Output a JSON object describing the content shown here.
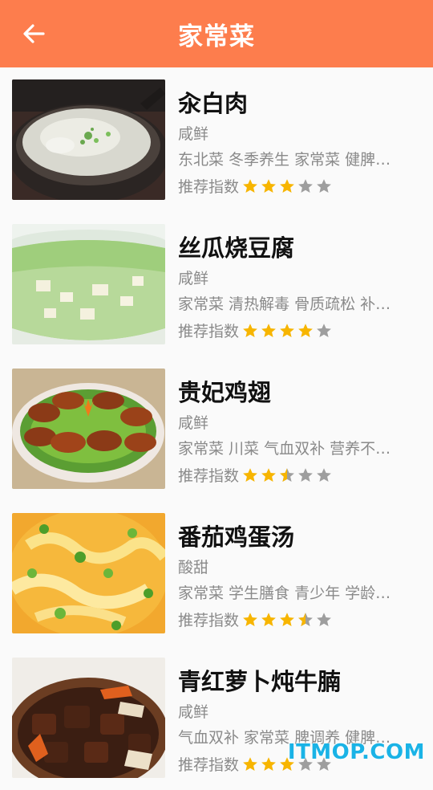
{
  "header": {
    "title": "家常菜",
    "back_icon": "arrow-left-icon",
    "background": "#fd7d4d"
  },
  "rating_label": "推荐指数",
  "star_color": "#f7b500",
  "star_empty_color": "#9e9e9e",
  "dishes": [
    {
      "name": "汆白肉",
      "taste": "咸鲜",
      "tags": "东北菜 冬季养生 家常菜 健脾…",
      "rating": 3
    },
    {
      "name": "丝瓜烧豆腐",
      "taste": "咸鲜",
      "tags": "家常菜 清热解毒 骨质疏松 补…",
      "rating": 4
    },
    {
      "name": "贵妃鸡翅",
      "taste": "咸鲜",
      "tags": "家常菜 川菜 气血双补 营养不…",
      "rating": 2.5
    },
    {
      "name": "番茄鸡蛋汤",
      "taste": "酸甜",
      "tags": "家常菜 学生膳食 青少年 学龄…",
      "rating": 3.5
    },
    {
      "name": "青红萝卜炖牛腩",
      "taste": "咸鲜",
      "tags": "气血双补 家常菜 脾调养 健脾…",
      "rating": 3
    }
  ],
  "watermark": "ITMOP.COM"
}
